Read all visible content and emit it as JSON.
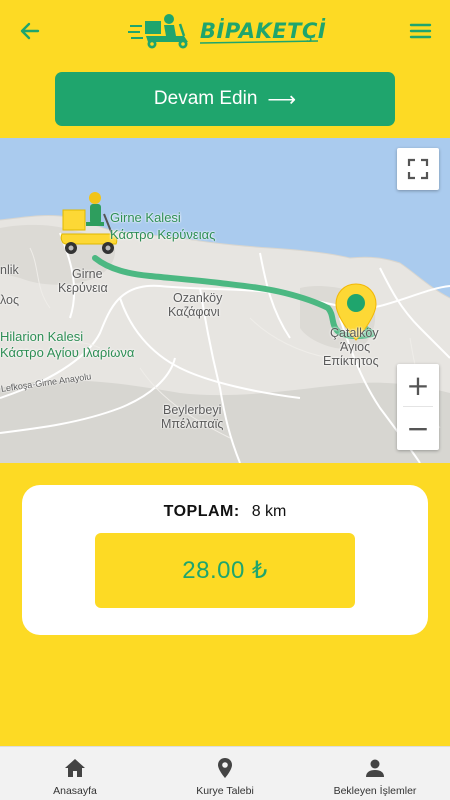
{
  "header": {
    "back_icon": "arrow-left-icon",
    "logo_text": "BİPAKETÇİ",
    "menu_icon": "hamburger-menu-icon",
    "accent_color": "#1FA56D",
    "background_color": "#FDDA24"
  },
  "continue_button": {
    "label": "Devam Edin",
    "arrow": "⟶"
  },
  "map": {
    "labels": {
      "girne_kalesi": "Girne Kalesi",
      "girne_kalesi_gr": "Κάστρο Κερύνειας",
      "girne": "Girne",
      "girne_gr": "Κερύνεια",
      "ozankoy": "Ozanköy",
      "ozankoy_gr": "Καζάφανι",
      "catalkoy": "Çatalköy",
      "catalkoy_gr": "Άγιος",
      "catalkoy_gr2": "Επίκτητος",
      "hilarion": "Hilarion Kalesi",
      "hilarion_gr": "Κάστρο Αγίου Ιλαρίωνα",
      "beylerbeyi": "Beylerbeyi",
      "beylerbeyi_gr": "Μπέλαπαϊς",
      "road": "Lefkoşa-Girne Anayolu",
      "left_cut1": "nlik",
      "left_cut2": "λος"
    },
    "fullscreen_icon": "fullscreen-icon",
    "zoom_in": "+",
    "zoom_out": "−",
    "route_color": "#4CB882",
    "courier_icon": "courier-scooter-icon",
    "destination_icon": "destination-pin-icon"
  },
  "summary": {
    "total_label": "TOPLAM:",
    "distance": "8 km",
    "price": "28.00 ₺"
  },
  "nav": [
    {
      "label": "Anasayfa",
      "icon": "home-icon"
    },
    {
      "label": "Kurye Talebi",
      "icon": "location-pin-icon"
    },
    {
      "label": "Bekleyen İşlemler",
      "icon": "person-icon"
    }
  ]
}
